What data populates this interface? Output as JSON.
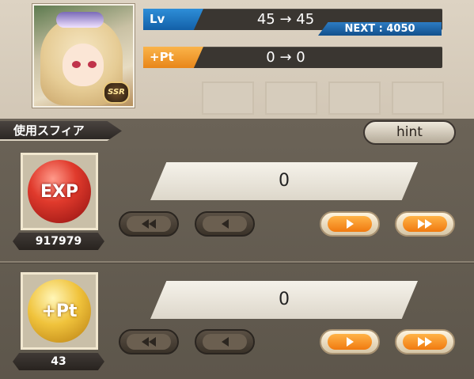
{
  "header": {
    "level": {
      "tag": "Lv",
      "value": "45 → 45",
      "next": "NEXT : 4050"
    },
    "points": {
      "tag": "+Pt",
      "value": "0 → 0"
    },
    "rarity_badge": "SSR"
  },
  "section": {
    "title": "使用スフィア",
    "hint_label": "hint"
  },
  "items": [
    {
      "icon_text": "EXP",
      "count": "917979",
      "value": "0"
    },
    {
      "icon_text": "+Pt",
      "count": "43",
      "value": "0"
    }
  ],
  "colors": {
    "level_tag": "#1a74c4",
    "points_tag": "#f29a2e",
    "panel": "#625a4f",
    "button_orange": "#f0891c"
  }
}
